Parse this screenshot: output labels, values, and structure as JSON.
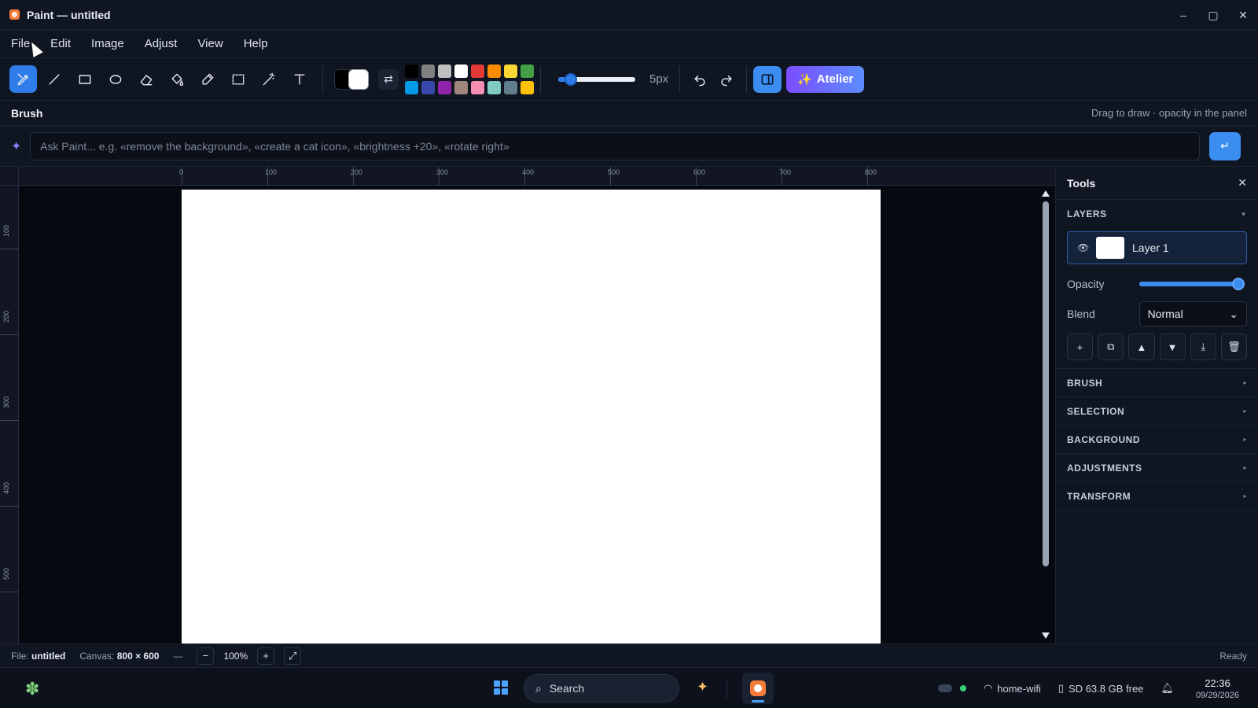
{
  "window": {
    "title": "Paint — untitled",
    "controls": {
      "minimize": "–",
      "maximize": "▢",
      "close": "✕"
    }
  },
  "menu": [
    "File",
    "Edit",
    "Image",
    "Adjust",
    "View",
    "Help"
  ],
  "toolbar": {
    "tools": [
      {
        "id": "brush",
        "icon": "brush-icon",
        "active": true
      },
      {
        "id": "line",
        "icon": "line-icon"
      },
      {
        "id": "rectangle",
        "icon": "rectangle-icon"
      },
      {
        "id": "ellipse",
        "icon": "ellipse-icon"
      },
      {
        "id": "eraser",
        "icon": "eraser-icon"
      },
      {
        "id": "fill",
        "icon": "paint-bucket-icon"
      },
      {
        "id": "picker",
        "icon": "eyedropper-icon"
      },
      {
        "id": "select",
        "icon": "selection-icon"
      },
      {
        "id": "magic",
        "icon": "magic-wand-icon"
      },
      {
        "id": "text",
        "icon": "text-icon"
      }
    ],
    "primary_color": "#000000",
    "secondary_color": "#ffffff",
    "swap_icon": "⇄",
    "palette": [
      "#000000",
      "#808080",
      "#c0c0c0",
      "#ffffff",
      "#e53935",
      "#fb8c00",
      "#fdd835",
      "#43a047",
      "#039be5",
      "#3949ab",
      "#8e24aa",
      "#a1887f",
      "#f48fb1",
      "#80cbc4",
      "#607d8b",
      "#ffc107"
    ],
    "brush_size_fraction": 0.1,
    "brush_size_label": "5px",
    "atelier_label": "Atelier",
    "atelier_icon": "✨"
  },
  "mode": {
    "name": "Brush",
    "hint": "Drag to draw · opacity in the panel"
  },
  "ask": {
    "icon": "✦",
    "placeholder": "Ask Paint... e.g. «remove the background», «create a cat icon», «brightness +20», «rotate right»",
    "send_icon": "↵"
  },
  "rulers": {
    "h": [
      "0",
      "100",
      "200",
      "300",
      "400",
      "500",
      "600",
      "700",
      "800"
    ],
    "v": [
      "100",
      "200",
      "300",
      "400",
      "500"
    ]
  },
  "panel": {
    "title": "Tools",
    "close": "✕",
    "layers_label": "LAYERS",
    "layer": {
      "name": "Layer 1",
      "eye": "👁"
    },
    "opacity_label": "Opacity",
    "opacity": 1.0,
    "blend_label": "Blend",
    "blend_value": "Normal",
    "layer_buttons": [
      "+",
      "⧉",
      "▲",
      "▼",
      "⤓",
      "🗑"
    ],
    "sections": [
      "BRUSH",
      "SELECTION",
      "BACKGROUND",
      "ADJUSTMENTS",
      "TRANSFORM"
    ]
  },
  "status": {
    "file_label": "File:",
    "file_value": "untitled",
    "canvas_label": "Canvas:",
    "canvas_value": "800 × 600",
    "dash": "—",
    "zoom_out": "−",
    "zoom": "100%",
    "zoom_in": "+",
    "fit": "⤢",
    "ready": "Ready"
  },
  "taskbar": {
    "search_placeholder": "Search",
    "wifi": "home-wifi",
    "storage": "SD 63.8 GB free",
    "time": "22:36",
    "date": "09/29/2026"
  }
}
